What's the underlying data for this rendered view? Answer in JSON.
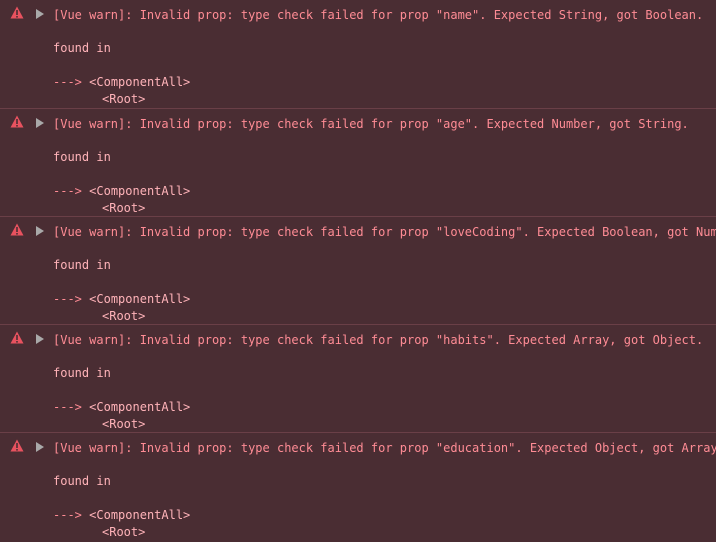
{
  "colors": {
    "background": "#4a2d33",
    "text": "#ffb3b9",
    "message": "#ff8c95",
    "icon": "#e8525f",
    "divider": "#6a3f47"
  },
  "icons": {
    "warning": "warning-triangle-icon",
    "expand": "expand-arrow-icon"
  },
  "entries": [
    {
      "message": "[Vue warn]: Invalid prop: type check failed for prop \"name\". Expected String, got Boolean.",
      "found_in": "found in",
      "trace_arrow": "--->",
      "trace_component": "<ComponentAll>",
      "trace_root": "<Root>"
    },
    {
      "message": "[Vue warn]: Invalid prop: type check failed for prop \"age\". Expected Number, got String.",
      "found_in": "found in",
      "trace_arrow": "--->",
      "trace_component": "<ComponentAll>",
      "trace_root": "<Root>"
    },
    {
      "message": "[Vue warn]: Invalid prop: type check failed for prop \"loveCoding\". Expected Boolean, got Number",
      "found_in": "found in",
      "trace_arrow": "--->",
      "trace_component": "<ComponentAll>",
      "trace_root": "<Root>"
    },
    {
      "message": "[Vue warn]: Invalid prop: type check failed for prop \"habits\". Expected Array, got Object.",
      "found_in": "found in",
      "trace_arrow": "--->",
      "trace_component": "<ComponentAll>",
      "trace_root": "<Root>"
    },
    {
      "message": "[Vue warn]: Invalid prop: type check failed for prop \"education\". Expected Object, got Array.",
      "found_in": "found in",
      "trace_arrow": "--->",
      "trace_component": "<ComponentAll>",
      "trace_root": "<Root>"
    }
  ]
}
